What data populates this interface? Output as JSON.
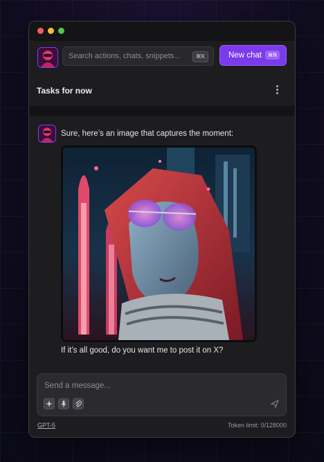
{
  "search": {
    "placeholder": "Search actions, chats, snippets...",
    "shortcut": "⌘K"
  },
  "new_chat": {
    "label": "New chat",
    "shortcut": "⌘N"
  },
  "header": {
    "title": "Tasks for now"
  },
  "messages": [
    {
      "role": "assistant",
      "text": "Sure, here’s an image that captures the moment:"
    },
    {
      "role": "assistant",
      "text": "If it’s all good, do you want me to post it on X?"
    }
  ],
  "composer": {
    "placeholder": "Send a message..."
  },
  "footer": {
    "model": "GPT-5",
    "token_limit": "Token limit: 0/128000"
  },
  "colors": {
    "accent": "#7c3aed",
    "window_bg": "#1d1d20",
    "page_bg": "#150f28"
  },
  "icons": {
    "window_controls": [
      "close-dot",
      "minimize-dot",
      "maximize-dot"
    ],
    "header_menu": "kebab-menu-icon",
    "composer_tools": [
      "sparkle-icon",
      "microphone-icon",
      "paperclip-icon"
    ],
    "send": "send-icon"
  }
}
